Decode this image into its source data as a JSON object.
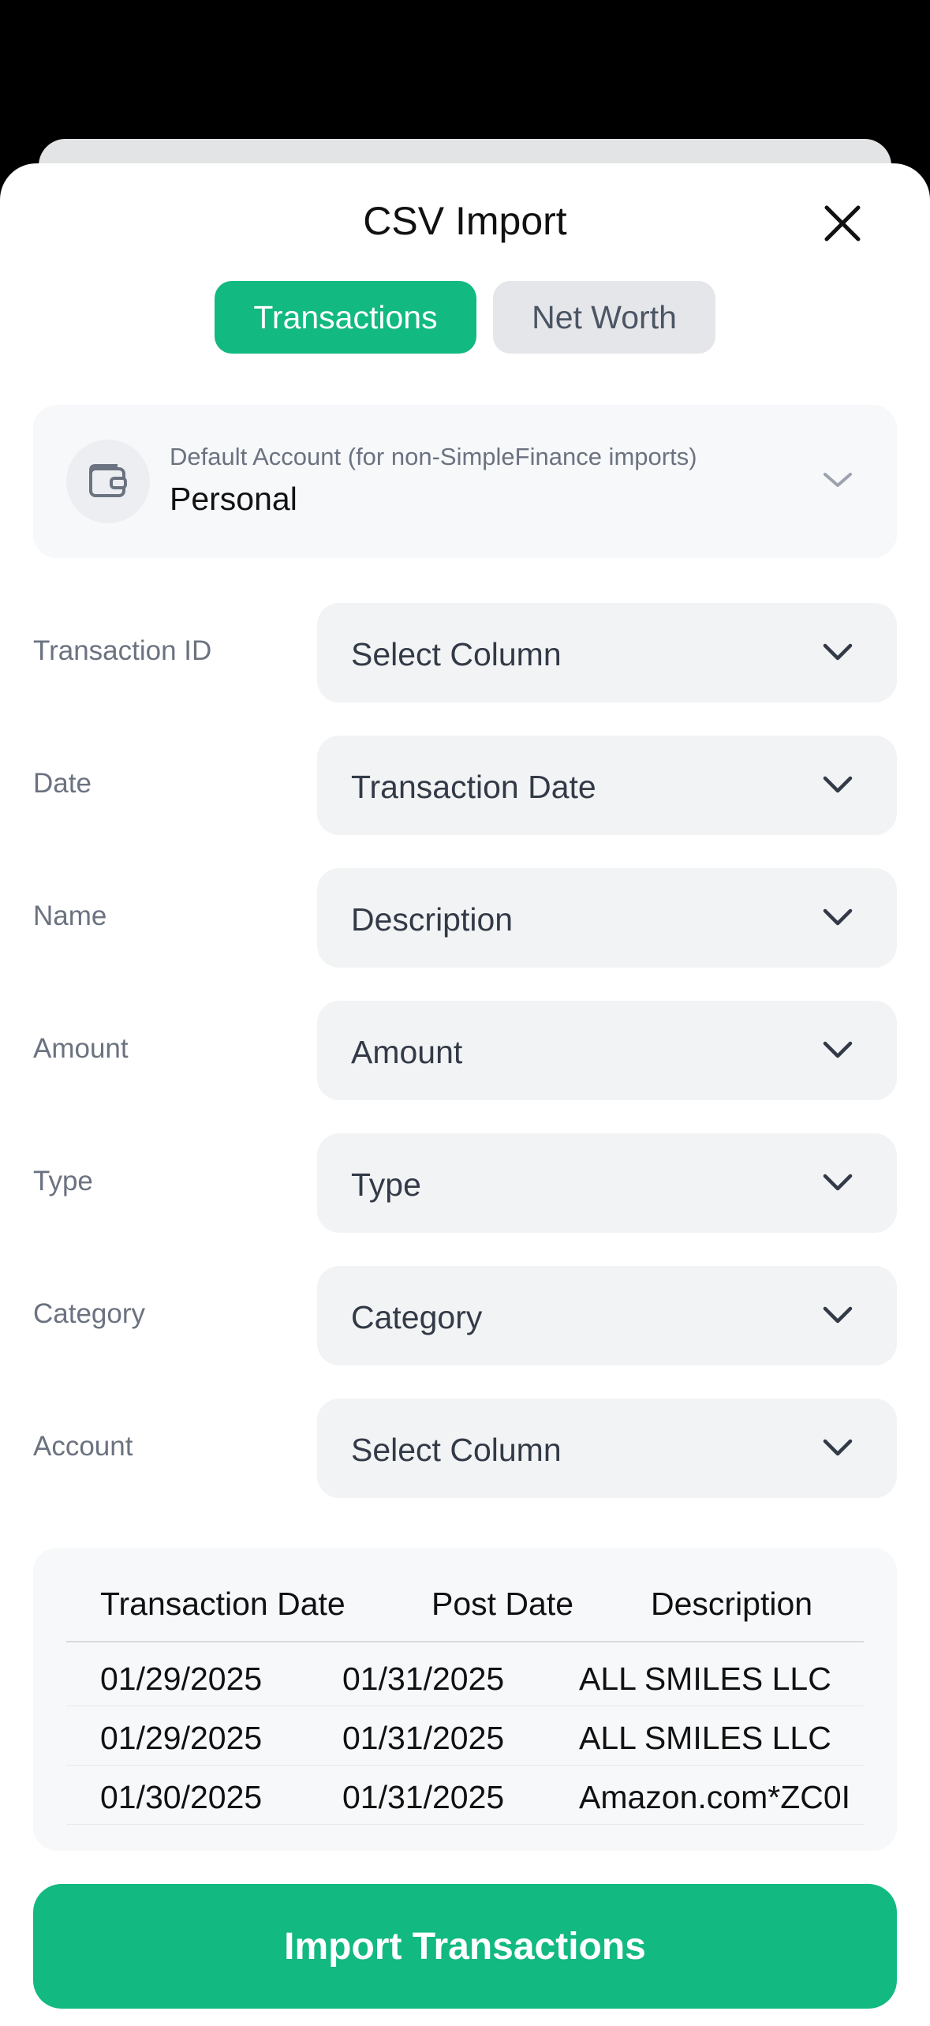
{
  "sheet": {
    "title": "CSV Import"
  },
  "tabs": [
    {
      "label": "Transactions",
      "active": true
    },
    {
      "label": "Net Worth",
      "active": false
    }
  ],
  "default_account": {
    "label": "Default Account (for non-SimpleFinance imports)",
    "value": "Personal"
  },
  "mappings": [
    {
      "label": "Transaction ID",
      "value": "Select Column"
    },
    {
      "label": "Date",
      "value": "Transaction Date"
    },
    {
      "label": "Name",
      "value": "Description"
    },
    {
      "label": "Amount",
      "value": "Amount"
    },
    {
      "label": "Type",
      "value": "Type"
    },
    {
      "label": "Category",
      "value": "Category"
    },
    {
      "label": "Account",
      "value": "Select Column"
    }
  ],
  "preview": {
    "headers": [
      "Transaction Date",
      "Post Date",
      "Description"
    ],
    "rows": [
      [
        "01/29/2025",
        "01/31/2025",
        "ALL SMILES LLC"
      ],
      [
        "01/29/2025",
        "01/31/2025",
        "ALL SMILES LLC"
      ],
      [
        "01/30/2025",
        "01/31/2025",
        "Amazon.com*ZC0I"
      ]
    ]
  },
  "import_button": "Import Transactions",
  "colors": {
    "accent": "#12b981",
    "background": "#ffffff",
    "field": "#f2f3f5"
  }
}
